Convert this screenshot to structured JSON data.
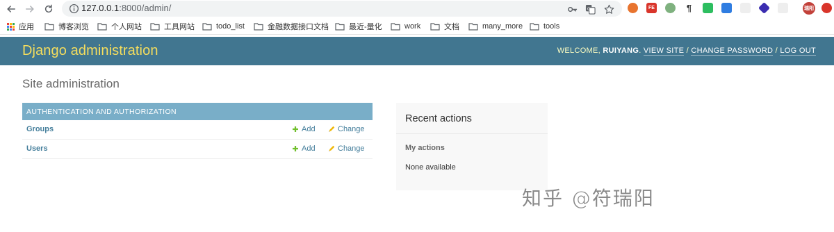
{
  "browser": {
    "url_host": "127.0.0.1",
    "url_path": ":8000/admin/",
    "bookmarks": [
      {
        "label": "应用",
        "kind": "apps"
      },
      {
        "label": "博客浏览",
        "kind": "folder"
      },
      {
        "label": "个人网站",
        "kind": "folder"
      },
      {
        "label": "工具网站",
        "kind": "folder"
      },
      {
        "label": "todo_list",
        "kind": "folder"
      },
      {
        "label": "金融数据接口文档",
        "kind": "folder"
      },
      {
        "label": "最近-量化",
        "kind": "folder"
      },
      {
        "label": "work",
        "kind": "folder"
      },
      {
        "label": "文档",
        "kind": "folder"
      },
      {
        "label": "many_more",
        "kind": "folder"
      },
      {
        "label": "tools",
        "kind": "folder"
      }
    ],
    "extensions": [
      {
        "name": "orange-extension-icon",
        "color": "#e8742f",
        "text": ""
      },
      {
        "name": "fe-extension-icon",
        "color": "#d9352b",
        "text": "FE"
      },
      {
        "name": "green-circle-extension-icon",
        "color": "#7fb17f",
        "text": ""
      },
      {
        "name": "paragraph-extension-icon",
        "color": "#ffffff",
        "text": "¶"
      },
      {
        "name": "evernote-extension-icon",
        "color": "#2dbe60",
        "text": ""
      },
      {
        "name": "download-extension-icon",
        "color": "#2f7de1",
        "text": ""
      },
      {
        "name": "clock-extension-icon",
        "color": "#eeeeee",
        "text": ""
      },
      {
        "name": "diamond-extension-icon",
        "color": "#3b2db0",
        "text": ""
      },
      {
        "name": "blank-extension-icon",
        "color": "#eeeeee",
        "text": ""
      },
      {
        "name": "profile-avatar",
        "color": "#c2413a",
        "text": "瑞阳"
      },
      {
        "name": "red-up-extension-icon",
        "color": "#d9352b",
        "text": ""
      }
    ]
  },
  "header": {
    "brand": "Django administration",
    "welcome": "WELCOME,",
    "username": "RUIYANG",
    "view_site": "VIEW SITE",
    "change_password": "CHANGE PASSWORD",
    "log_out": "LOG OUT",
    "separator": "/"
  },
  "content": {
    "title": "Site administration",
    "app_caption": "AUTHENTICATION AND AUTHORIZATION",
    "models": [
      {
        "name": "Groups",
        "add": "Add",
        "change": "Change"
      },
      {
        "name": "Users",
        "add": "Add",
        "change": "Change"
      }
    ],
    "recent_title": "Recent actions",
    "my_actions": "My actions",
    "none_available": "None available"
  },
  "watermark": "知乎 @符瑞阳",
  "colors": {
    "header_bg": "#417690",
    "brand": "#f5dd5d",
    "caption_bg": "#79aec8",
    "link": "#447e9b",
    "add_icon": "#70bf2b",
    "change_icon": "#efb80b"
  }
}
